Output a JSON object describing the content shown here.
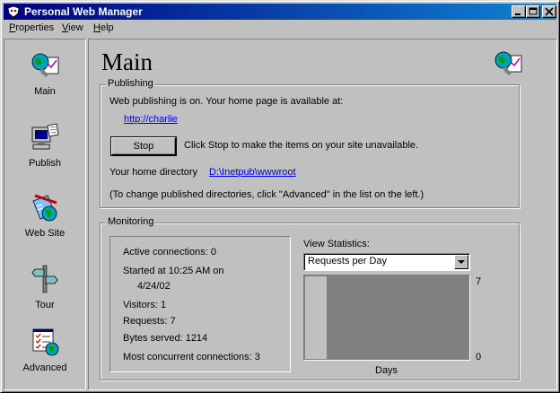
{
  "window": {
    "title": "Personal Web Manager",
    "controls": {
      "minimize": "_",
      "maximize": "□",
      "close": "×"
    }
  },
  "menu": [
    {
      "label": "Properties",
      "key": "P",
      "rest": "roperties"
    },
    {
      "label": "View",
      "key": "V",
      "rest": "iew"
    },
    {
      "label": "Help",
      "key": "H",
      "rest": "elp"
    }
  ],
  "sidebar": {
    "items": [
      {
        "label": "Main",
        "icon": "globe-magnifier-icon"
      },
      {
        "label": "Publish",
        "icon": "computer-publish-icon"
      },
      {
        "label": "Web Site",
        "icon": "website-tools-icon"
      },
      {
        "label": "Tour",
        "icon": "signpost-icon"
      },
      {
        "label": "Advanced",
        "icon": "advanced-checklist-icon"
      }
    ]
  },
  "main": {
    "title": "Main",
    "publishing": {
      "label": "Publishing",
      "status_text": "Web publishing is on. Your home page is available at:",
      "home_url": "http://charlie",
      "stop_button": "Stop",
      "stop_hint": "Click Stop to make the items on your site unavailable.",
      "home_dir_label": "Your home directory",
      "home_dir": "D:\\Inetpub\\wwwroot",
      "advanced_hint": "(To change published directories, click \"Advanced\" in the list on the left.)"
    },
    "monitoring": {
      "label": "Monitoring",
      "active_connections": "Active connections: 0",
      "started_line1": "Started at 10:25 AM on",
      "started_line2": "4/24/02",
      "visitors": "Visitors: 1",
      "requests": "Requests: 7",
      "bytes_served": "Bytes served: 1214",
      "most_concurrent": "Most concurrent connections: 3",
      "view_statistics_label": "View Statistics:",
      "view_statistics_selected": "Requests per Day"
    }
  },
  "chart_data": {
    "type": "bar",
    "xlabel": "Days",
    "ylim": [
      0,
      7
    ],
    "y_ticks": [
      "7",
      "0"
    ],
    "categories": [
      "",
      "",
      "",
      "",
      "",
      "",
      "",
      ""
    ],
    "values": [
      0,
      0,
      0,
      0,
      0,
      0,
      0,
      0
    ],
    "colors": {
      "plot_bg": "#808080",
      "track": "#c0c0c0",
      "bar": "#c0c0c0"
    }
  }
}
